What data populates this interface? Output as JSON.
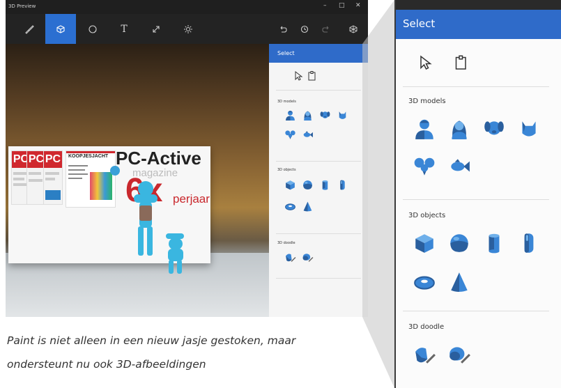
{
  "window": {
    "title": "3D Preview",
    "controls": {
      "minimize": "–",
      "maximize": "□",
      "close": "✕"
    }
  },
  "toolbar": {
    "tools": [
      {
        "icon": "brush-icon"
      },
      {
        "icon": "3d-cube-icon",
        "active": true
      },
      {
        "icon": "sticker-icon"
      },
      {
        "icon": "text-icon",
        "label": "T"
      },
      {
        "icon": "resize-icon"
      },
      {
        "icon": "effects-icon"
      }
    ],
    "right_tools": [
      {
        "icon": "undo-icon"
      },
      {
        "icon": "history-icon"
      },
      {
        "icon": "redo-icon"
      },
      {
        "icon": "remix3d-icon"
      }
    ]
  },
  "poster": {
    "cover_label": "PC",
    "magazine_title": "KOOPJESJACHT",
    "brand": "PC-Active",
    "brand_sub": "magazine",
    "offer_big": "6x",
    "offer_small": "perjaar"
  },
  "panel": {
    "title": "Select",
    "tool_icons": [
      "cursor-icon",
      "clipboard-icon"
    ],
    "sections": [
      {
        "title": "3D models",
        "items": [
          "man-icon",
          "woman-icon",
          "dog-icon",
          "cat-icon",
          "mouse-icon",
          "fish-icon"
        ]
      },
      {
        "title": "3D objects",
        "items": [
          "cube-icon",
          "sphere-icon",
          "cylinder-icon",
          "capsule-icon",
          "torus-icon",
          "cone-icon"
        ]
      },
      {
        "title": "3D doodle",
        "items": [
          "sharp-doodle-icon",
          "soft-doodle-icon"
        ]
      }
    ]
  },
  "caption": {
    "line1": "Paint is niet alleen in een nieuw jasje gestoken, maar",
    "line2": "ondersteunt nu ook 3D-afbeeldingen"
  },
  "colors": {
    "accent": "#2f6bc9",
    "model_blue": "#3a86d6",
    "dark_toolbar": "#232323",
    "panel_bg": "#f5f5f5"
  }
}
